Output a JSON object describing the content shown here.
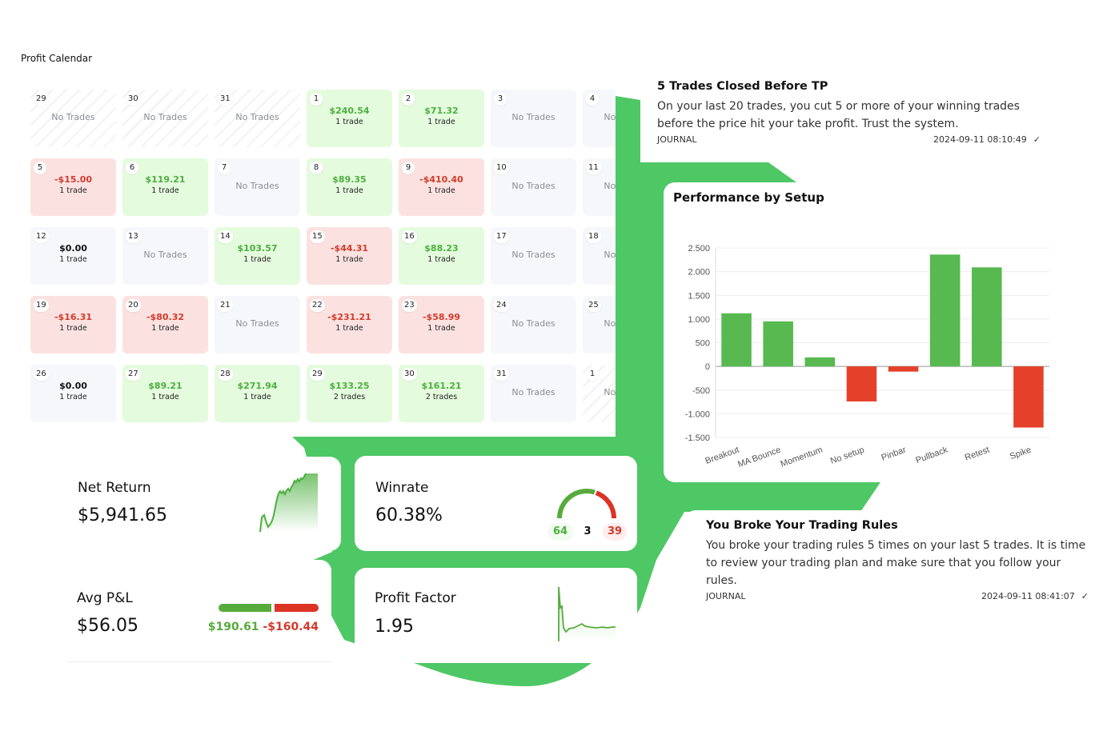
{
  "page": {
    "title": "Profit Calendar"
  },
  "colors": {
    "accent_green": "#4ec765",
    "win": "#4caf3f",
    "loss": "#d33a2c",
    "bar_win": "#57b94f",
    "bar_loss": "#e5412a"
  },
  "calendar": {
    "weeks": [
      [
        {
          "day": "29",
          "status": "out",
          "text": "No Trades"
        },
        {
          "day": "30",
          "status": "out",
          "text": "No Trades"
        },
        {
          "day": "31",
          "status": "out",
          "text": "No Trades"
        },
        {
          "day": "1",
          "status": "win",
          "amount": "$240.54",
          "trades": "1 trade"
        },
        {
          "day": "2",
          "status": "win",
          "amount": "$71.32",
          "trades": "1 trade"
        },
        {
          "day": "3",
          "status": "none",
          "text": "No Trades"
        },
        {
          "day": "4",
          "status": "none",
          "text": "No Trades"
        }
      ],
      [
        {
          "day": "5",
          "status": "loss",
          "amount": "-$15.00",
          "trades": "1 trade"
        },
        {
          "day": "6",
          "status": "win",
          "amount": "$119.21",
          "trades": "1 trade"
        },
        {
          "day": "7",
          "status": "none",
          "text": "No Trades"
        },
        {
          "day": "8",
          "status": "win",
          "amount": "$89.35",
          "trades": "1 trade"
        },
        {
          "day": "9",
          "status": "loss",
          "amount": "-$410.40",
          "trades": "1 trade"
        },
        {
          "day": "10",
          "status": "none",
          "text": "No Trades"
        },
        {
          "day": "11",
          "status": "none",
          "text": "No Trades"
        }
      ],
      [
        {
          "day": "12",
          "status": "zero",
          "amount": "$0.00",
          "trades": "1 trade"
        },
        {
          "day": "13",
          "status": "none",
          "text": "No Trades"
        },
        {
          "day": "14",
          "status": "win",
          "amount": "$103.57",
          "trades": "1 trade"
        },
        {
          "day": "15",
          "status": "loss",
          "amount": "-$44.31",
          "trades": "1 trade"
        },
        {
          "day": "16",
          "status": "win",
          "amount": "$88.23",
          "trades": "1 trade"
        },
        {
          "day": "17",
          "status": "none",
          "text": "No Trades"
        },
        {
          "day": "18",
          "status": "none",
          "text": "No Trades"
        }
      ],
      [
        {
          "day": "19",
          "status": "loss",
          "amount": "-$16.31",
          "trades": "1 trade"
        },
        {
          "day": "20",
          "status": "loss",
          "amount": "-$80.32",
          "trades": "1 trade"
        },
        {
          "day": "21",
          "status": "none",
          "text": "No Trades"
        },
        {
          "day": "22",
          "status": "loss",
          "amount": "-$231.21",
          "trades": "1 trade"
        },
        {
          "day": "23",
          "status": "loss",
          "amount": "-$58.99",
          "trades": "1 trade"
        },
        {
          "day": "24",
          "status": "none",
          "text": "No Trades"
        },
        {
          "day": "25",
          "status": "none",
          "text": "No Trades"
        }
      ],
      [
        {
          "day": "26",
          "status": "zero",
          "amount": "$0.00",
          "trades": "1 trade"
        },
        {
          "day": "27",
          "status": "win",
          "amount": "$89.21",
          "trades": "1 trade"
        },
        {
          "day": "28",
          "status": "win",
          "amount": "$271.94",
          "trades": "1 trade"
        },
        {
          "day": "29",
          "status": "win",
          "amount": "$133.25",
          "trades": "2 trades"
        },
        {
          "day": "30",
          "status": "win",
          "amount": "$161.21",
          "trades": "2 trades"
        },
        {
          "day": "31",
          "status": "none",
          "text": "No Trades"
        },
        {
          "day": "1",
          "status": "out",
          "text": "No Trades"
        }
      ]
    ]
  },
  "insights": [
    {
      "title": "5 Trades Closed Before TP",
      "body": "On your last 20 trades, you cut 5 or more of your winning trades before the price hit your take profit. Trust the system.",
      "source": "JOURNAL",
      "timestamp": "2024-09-11 08:10:49",
      "status_icon": "check-icon"
    },
    {
      "title": "You Broke Your Trading Rules",
      "body": "You broke your trading rules 5 times on your last 5 trades. It is time to review your trading plan and make sure that you follow your rules.",
      "source": "JOURNAL",
      "timestamp": "2024-09-11 08:41:07",
      "status_icon": "check-icon"
    }
  ],
  "stats": {
    "net_return": {
      "label": "Net Return",
      "value": "$5,941.65"
    },
    "winrate": {
      "label": "Winrate",
      "value": "60.38%",
      "wins": "64",
      "breakeven": "3",
      "losses": "39",
      "win_fraction": 0.604
    },
    "avg_pnl": {
      "label": "Avg P&L",
      "value": "$56.05",
      "avg_win": "$190.61",
      "avg_loss": "-$160.44",
      "win_share": 0.543
    },
    "profit_factor": {
      "label": "Profit Factor",
      "value": "1.95"
    }
  },
  "chart_data": {
    "type": "bar",
    "title": "Performance by Setup",
    "categories": [
      "Breakout",
      "MA Bounce",
      "Momentum",
      "No setup",
      "Pinbar",
      "Pullback",
      "Retest",
      "Spike"
    ],
    "values": [
      1120,
      950,
      190,
      -740,
      -110,
      2360,
      2090,
      -1290
    ],
    "yticks": [
      "2.500",
      "2.000",
      "1.500",
      "1.000",
      "500",
      "0",
      "-500",
      "-1.000",
      "-1.500"
    ],
    "ytick_values": [
      2500,
      2000,
      1500,
      1000,
      500,
      0,
      -500,
      -1000,
      -1500
    ],
    "ylim": [
      -1500,
      2500
    ],
    "xlabel": "",
    "ylabel": "",
    "grid": true
  }
}
